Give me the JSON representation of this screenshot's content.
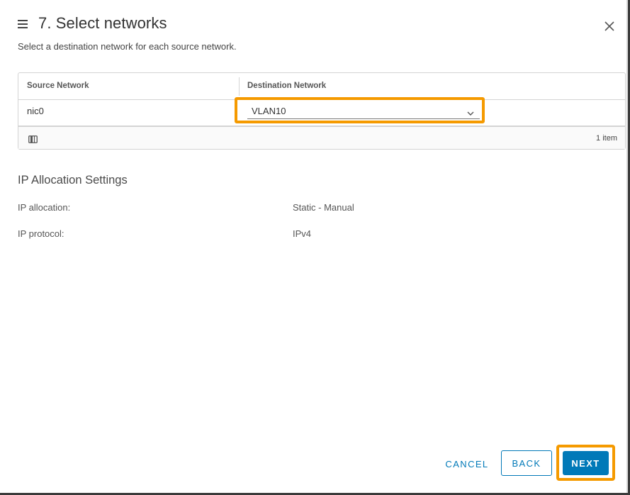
{
  "dialog": {
    "title": "7. Select networks",
    "subtitle": "Select a destination network for each source network."
  },
  "grid": {
    "columns": [
      "Source Network",
      "Destination Network"
    ],
    "rows": [
      {
        "source": "nic0",
        "destination": "VLAN10"
      }
    ],
    "footer_count": "1 item"
  },
  "ip_settings": {
    "title": "IP Allocation Settings",
    "items": [
      {
        "label": "IP allocation:",
        "value": "Static - Manual"
      },
      {
        "label": "IP protocol:",
        "value": "IPv4"
      }
    ]
  },
  "buttons": {
    "cancel": "CANCEL",
    "back": "BACK",
    "next": "NEXT"
  },
  "icons": {
    "menu": "hamburger-menu-icon",
    "close": "close-icon",
    "column_toggle": "column-toggle-icon",
    "dropdown": "chevron-down-icon"
  },
  "colors": {
    "accent": "#0079b8",
    "highlight": "#f59a00",
    "text": "#333333"
  }
}
